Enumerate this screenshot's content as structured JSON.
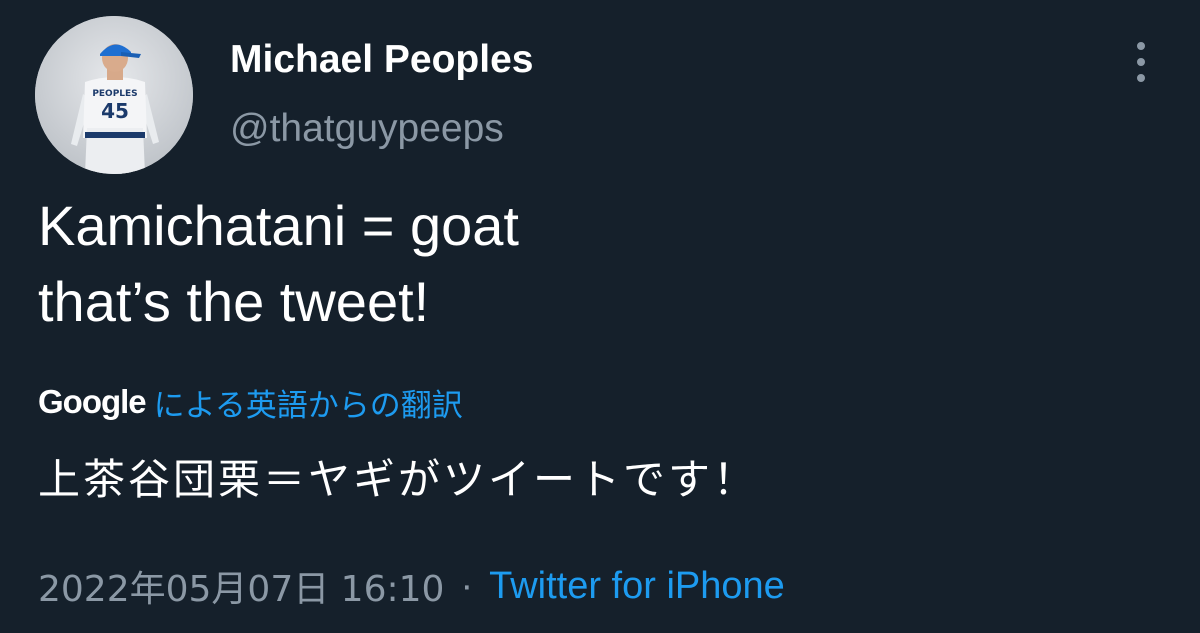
{
  "author": {
    "display_name": "Michael Peoples",
    "handle": "@thatguypeeps",
    "avatar": {
      "jersey_name": "PEOPLES",
      "jersey_number": "45"
    }
  },
  "tweet": {
    "lines": [
      "Kamichatani = goat",
      "that’s the tweet!"
    ]
  },
  "translation": {
    "provider": "Google",
    "label": "による英語からの翻訳",
    "text": "上茶谷団栗＝ヤギがツイートです！"
  },
  "meta": {
    "timestamp": "2022年05月07日 16:10",
    "separator": "·",
    "source": "Twitter for iPhone"
  },
  "colors": {
    "background": "#15202b",
    "primary_text": "#ffffff",
    "secondary_text": "#8b98a5",
    "link": "#1d9bf0"
  },
  "icons": {
    "more": "vertical-ellipsis-icon"
  }
}
